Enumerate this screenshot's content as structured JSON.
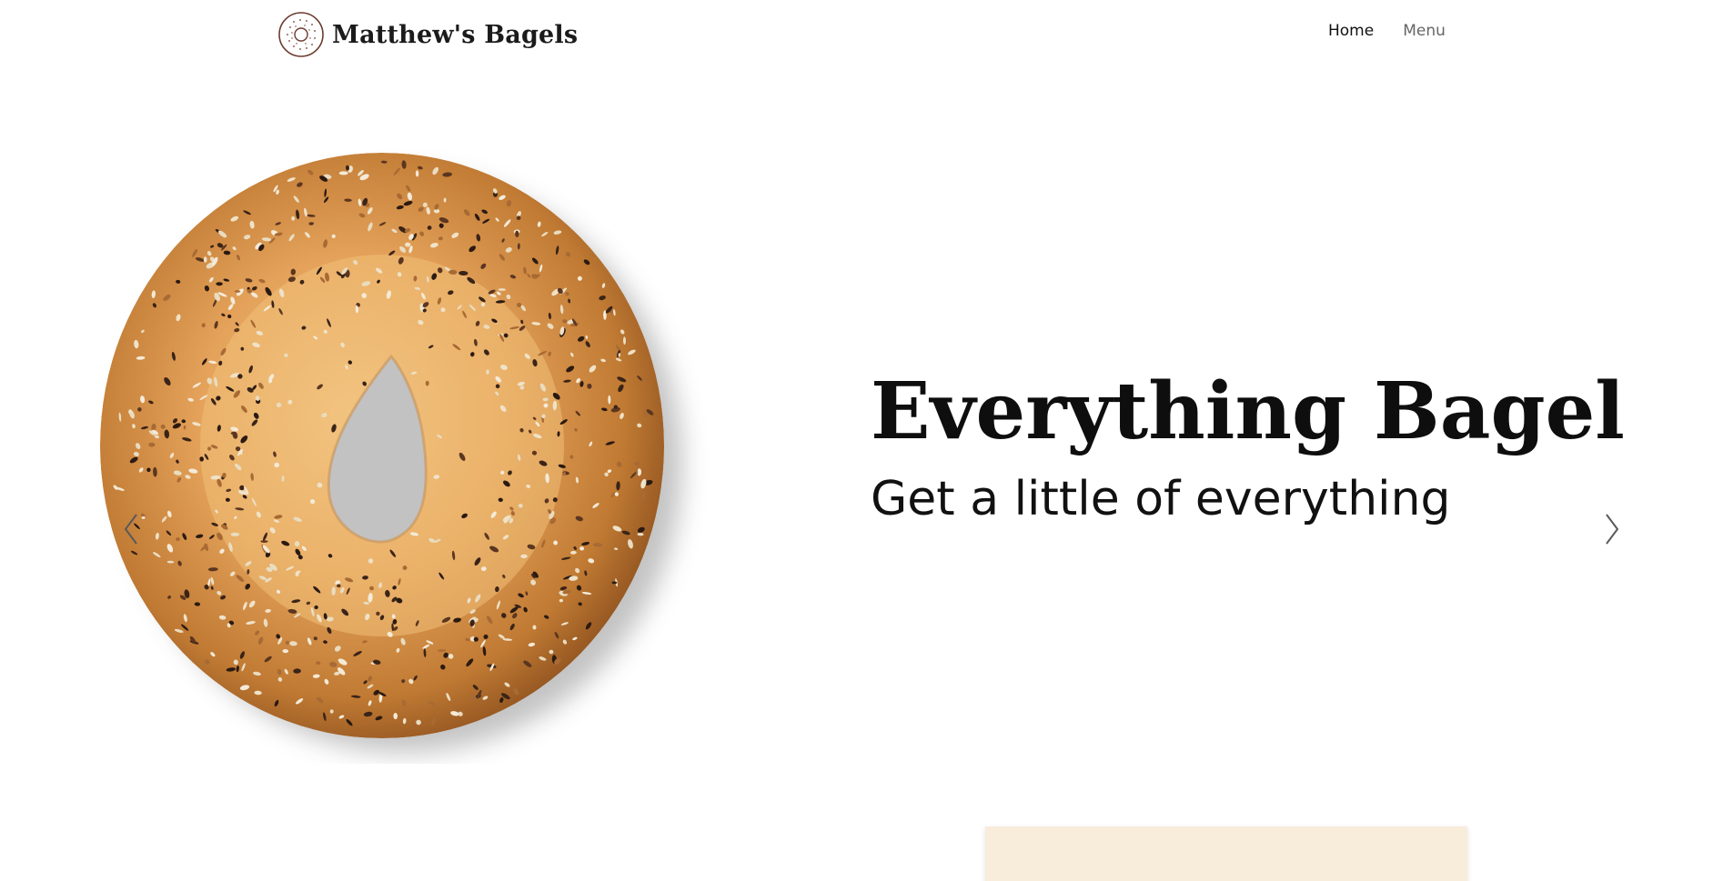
{
  "brand": {
    "name": "Matthew's Bagels",
    "logo_icon": "bagel-logo-icon"
  },
  "nav": {
    "items": [
      {
        "label": "Home",
        "active": true
      },
      {
        "label": "Menu",
        "active": false
      }
    ]
  },
  "hero": {
    "title": "Everything Bagel",
    "subtitle": "Get a little of everything",
    "image": "everything-bagel-image",
    "prev_icon": "chevron-left-icon",
    "next_icon": "chevron-right-icon"
  },
  "colors": {
    "card_background": "#f8ecdb",
    "nav_active": "#111111",
    "nav_inactive": "#666666",
    "bagel_crust": "#c07a33"
  }
}
